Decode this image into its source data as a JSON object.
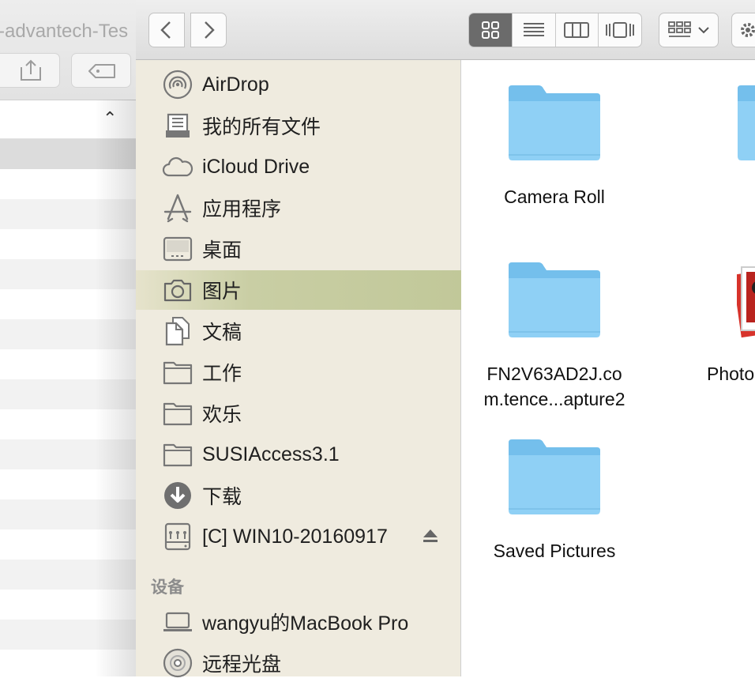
{
  "background_window": {
    "title": "-advantech-Tes"
  },
  "toolbar": {
    "back_label": "Back",
    "forward_label": "Forward",
    "view_modes": [
      "icon-view",
      "list-view",
      "column-view",
      "cover-flow-view"
    ],
    "active_view": "icon-view"
  },
  "sidebar": {
    "favorites": [
      {
        "label": "AirDrop",
        "icon": "airdrop-icon"
      },
      {
        "label": "我的所有文件",
        "icon": "all-my-files-icon"
      },
      {
        "label": "iCloud Drive",
        "icon": "icloud-icon"
      },
      {
        "label": "应用程序",
        "icon": "applications-icon"
      },
      {
        "label": "桌面",
        "icon": "desktop-icon"
      },
      {
        "label": "图片",
        "icon": "camera-icon",
        "selected": true
      },
      {
        "label": "文稿",
        "icon": "documents-icon"
      },
      {
        "label": "工作",
        "icon": "folder-icon"
      },
      {
        "label": "欢乐",
        "icon": "folder-icon"
      },
      {
        "label": "SUSIAccess3.1",
        "icon": "folder-icon"
      },
      {
        "label": "下载",
        "icon": "downloads-icon"
      },
      {
        "label": "[C] WIN10-20160917",
        "icon": "network-drive-icon",
        "ejectable": true
      }
    ],
    "devices_header": "设备",
    "devices": [
      {
        "label": "wangyu的MacBook Pro",
        "icon": "laptop-icon"
      },
      {
        "label": "远程光盘",
        "icon": "remote-disc-icon"
      }
    ]
  },
  "content": {
    "items": [
      {
        "name_line1": "Camera Roll",
        "name_line2": "",
        "type": "folder"
      },
      {
        "name_line1": "FN2V63AD2J.co",
        "name_line2": "m.tence...apture2",
        "type": "folder"
      },
      {
        "name_line1": "Saved Pictures",
        "name_line2": "",
        "type": "folder"
      },
      {
        "name_line1": "Photo",
        "name_line2": "",
        "type": "photos-library"
      }
    ]
  },
  "colors": {
    "sidebar_bg": "#efebdf",
    "selected_row": "#c1c899",
    "folder_blue": "#8fd0f5"
  }
}
